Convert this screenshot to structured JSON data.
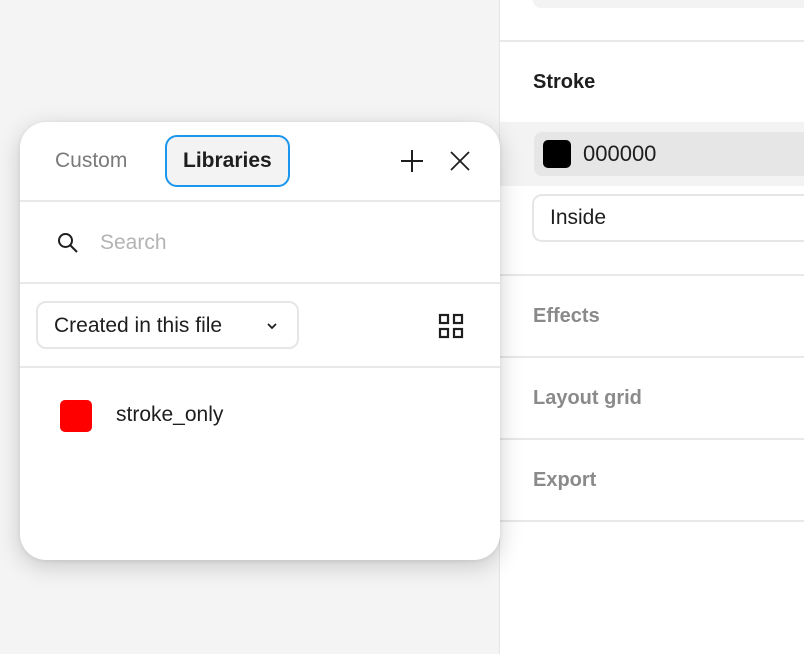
{
  "canvas": {},
  "properties_panel": {
    "stroke": {
      "title": "Stroke",
      "color_hex": "000000",
      "color_value": "#000000",
      "position": "Inside"
    },
    "sections": [
      {
        "label": "Effects"
      },
      {
        "label": "Layout grid"
      },
      {
        "label": "Export"
      }
    ]
  },
  "style_picker": {
    "tabs": [
      {
        "label": "Custom",
        "active": false
      },
      {
        "label": "Libraries",
        "active": true
      }
    ],
    "add_icon": "plus-icon",
    "close_icon": "close-icon",
    "search": {
      "value": "",
      "placeholder": "Search"
    },
    "filter": {
      "selected": "Created in this file"
    },
    "view_icon": "grid-view-icon",
    "styles": [
      {
        "name": "stroke_only",
        "color": "#ff0000"
      }
    ]
  },
  "colors": {
    "accent": "#1a96ee",
    "swatch_red": "#ff0000"
  }
}
